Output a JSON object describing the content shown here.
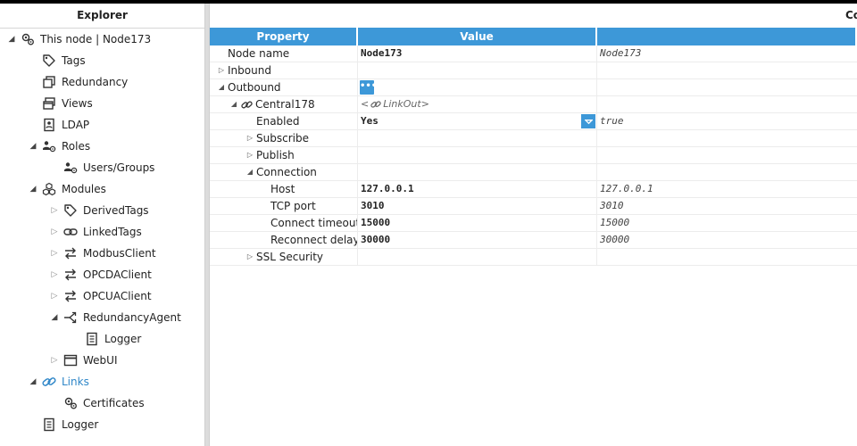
{
  "explorer": {
    "title": "Explorer",
    "items": [
      {
        "label": "This node | Node173",
        "icon": "gears-icon",
        "toggle": "expanded"
      },
      {
        "label": "Tags",
        "icon": "tag-icon",
        "toggle": ""
      },
      {
        "label": "Redundancy",
        "icon": "copy-icon",
        "toggle": ""
      },
      {
        "label": "Views",
        "icon": "windows-icon",
        "toggle": ""
      },
      {
        "label": "LDAP",
        "icon": "ldap-icon",
        "toggle": ""
      },
      {
        "label": "Roles",
        "icon": "users-gear-icon",
        "toggle": "expanded"
      },
      {
        "label": "Users/Groups",
        "icon": "users-gear-icon",
        "toggle": ""
      },
      {
        "label": "Modules",
        "icon": "cubes-icon",
        "toggle": "expanded"
      },
      {
        "label": "DerivedTags",
        "icon": "tag-icon",
        "toggle": "collapsed"
      },
      {
        "label": "LinkedTags",
        "icon": "link-icon",
        "toggle": "collapsed"
      },
      {
        "label": "ModbusClient",
        "icon": "arrows-exchange-icon",
        "toggle": "collapsed"
      },
      {
        "label": "OPCDAClient",
        "icon": "arrows-exchange-icon",
        "toggle": "collapsed"
      },
      {
        "label": "OPCUAClient",
        "icon": "arrows-exchange-icon",
        "toggle": "collapsed"
      },
      {
        "label": "RedundancyAgent",
        "icon": "branch-icon",
        "toggle": "expanded"
      },
      {
        "label": "Logger",
        "icon": "book-icon",
        "toggle": ""
      },
      {
        "label": "WebUI",
        "icon": "window-icon",
        "toggle": "collapsed"
      },
      {
        "label": "Links",
        "icon": "link-icon",
        "toggle": "expanded"
      },
      {
        "label": "Certificates",
        "icon": "gears-icon",
        "toggle": ""
      },
      {
        "label": "Logger",
        "icon": "book-icon",
        "toggle": ""
      }
    ]
  },
  "panel": {
    "title": "Co"
  },
  "grid": {
    "headers": [
      "Property",
      "Value",
      ""
    ],
    "rows": [
      {
        "name": "Node name",
        "value": "Node173",
        "raw": "Node173",
        "toggle": ""
      },
      {
        "name": "Inbound",
        "value": "",
        "raw": "",
        "toggle": "collapsed"
      },
      {
        "name": "Outbound",
        "value": "",
        "raw": "",
        "toggle": "expanded",
        "button": "•••"
      },
      {
        "name": "Central178",
        "value": "<",
        "link_value": "LinkOut>",
        "raw": "",
        "toggle": "expanded"
      },
      {
        "name": "Enabled",
        "value": "Yes",
        "raw": "true",
        "toggle": ""
      },
      {
        "name": "Subscribe",
        "value": "",
        "raw": "",
        "toggle": "collapsed"
      },
      {
        "name": "Publish",
        "value": "",
        "raw": "",
        "toggle": "collapsed"
      },
      {
        "name": "Connection",
        "value": "",
        "raw": "",
        "toggle": "expanded"
      },
      {
        "name": "Host",
        "value": "127.0.0.1",
        "raw": "127.0.0.1",
        "toggle": ""
      },
      {
        "name": "TCP port",
        "value": "3010",
        "raw": "3010",
        "toggle": ""
      },
      {
        "name": "Connect timeout",
        "value": "15000",
        "raw": "15000",
        "toggle": ""
      },
      {
        "name": "Reconnect delay",
        "value": "30000",
        "raw": "30000",
        "toggle": ""
      },
      {
        "name": "SSL Security",
        "value": "",
        "raw": "",
        "toggle": "collapsed"
      }
    ]
  },
  "colors": {
    "accent": "#3d98d8",
    "active_link": "#2e86c8"
  }
}
